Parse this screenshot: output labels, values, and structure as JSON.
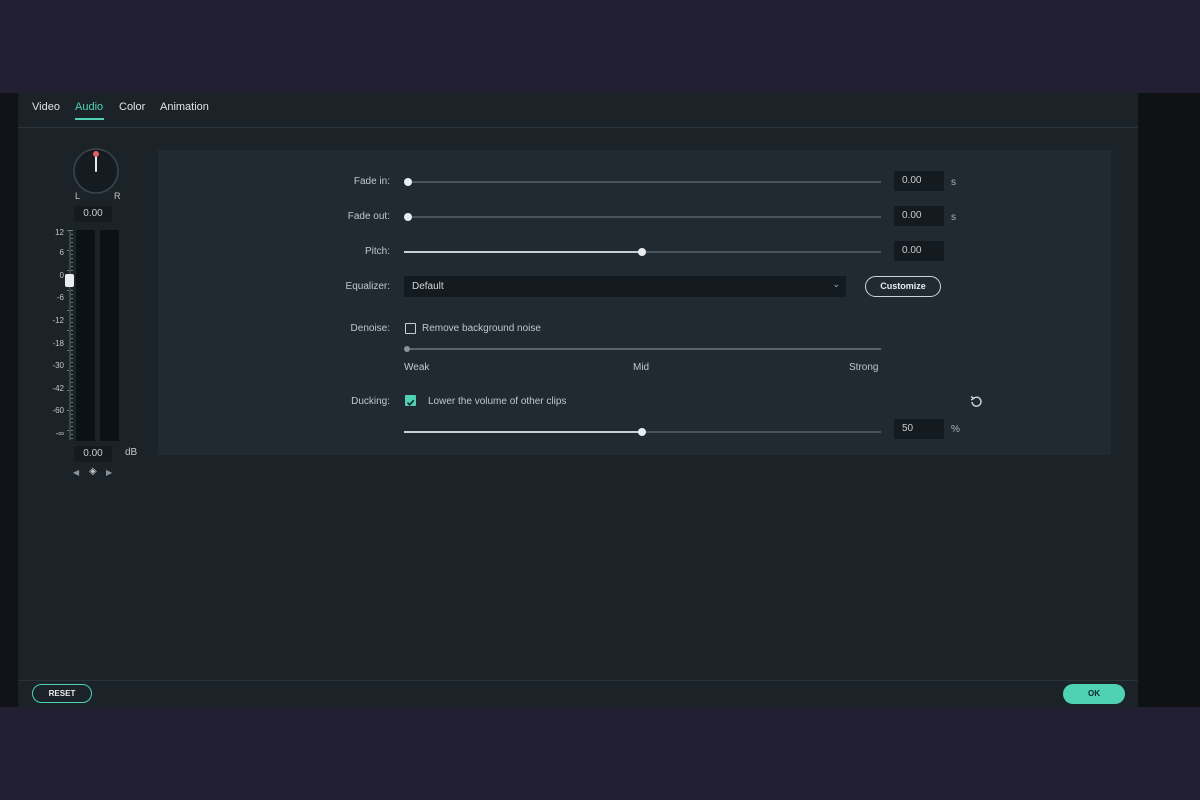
{
  "tabs": [
    {
      "label": "Video",
      "active": false
    },
    {
      "label": "Audio",
      "active": true
    },
    {
      "label": "Color",
      "active": false
    },
    {
      "label": "Animation",
      "active": false
    }
  ],
  "pan": {
    "left_label": "L",
    "right_label": "R",
    "value": "0.00"
  },
  "meter": {
    "scale": [
      "12",
      "6",
      "0",
      "-6",
      "-12",
      "-18",
      "-30",
      "-42",
      "-60",
      "-∞"
    ],
    "value": "0.00",
    "unit": "dB"
  },
  "fade_in": {
    "label": "Fade in:",
    "value": "0.00",
    "unit": "s",
    "level": 0
  },
  "fade_out": {
    "label": "Fade out:",
    "value": "0.00",
    "unit": "s",
    "level": 0
  },
  "pitch": {
    "label": "Pitch:",
    "value": "0.00",
    "level": 0.5
  },
  "equalizer": {
    "label": "Equalizer:",
    "selected": "Default",
    "customize_label": "Customize"
  },
  "denoise": {
    "label": "Denoise:",
    "checkbox_label": "Remove background noise",
    "checked": false,
    "levels": [
      "Weak",
      "Mid",
      "Strong"
    ],
    "level": 0
  },
  "ducking": {
    "label": "Ducking:",
    "checkbox_label": "Lower the volume of other clips",
    "checked": true,
    "value": "50",
    "unit": "%",
    "level": 0.5
  },
  "footer": {
    "reset_label": "RESET",
    "ok_label": "OK"
  },
  "colors": {
    "accent": "#4fd1b3",
    "background": "#1b2329",
    "panel": "#212a31",
    "knob_marker": "#e06060"
  }
}
